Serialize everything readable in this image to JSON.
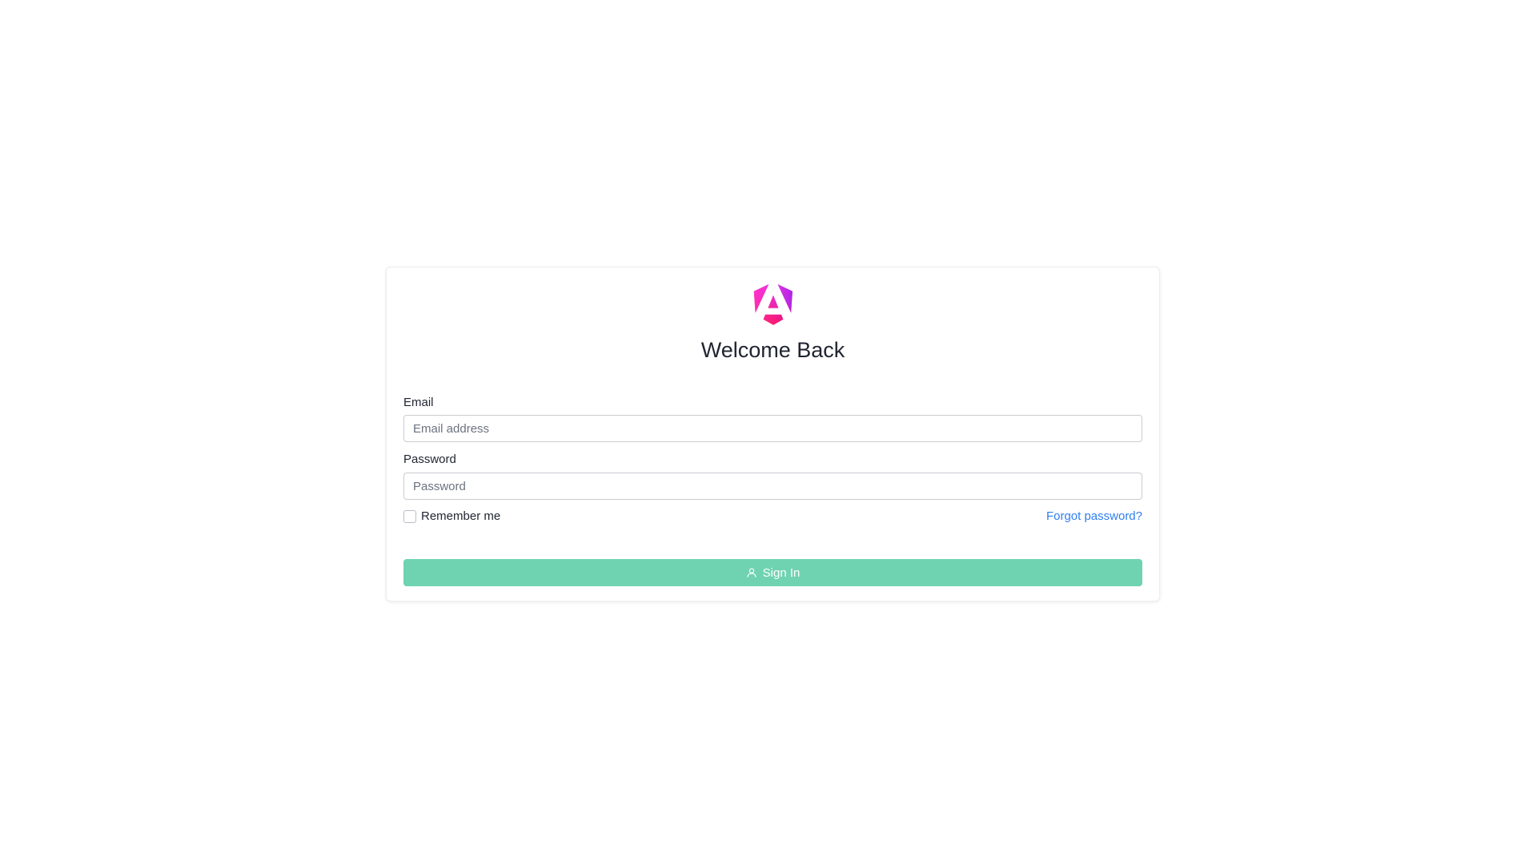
{
  "login": {
    "title": "Welcome Back",
    "logo_icon": "angular-logo-icon",
    "email": {
      "label": "Email",
      "placeholder": "Email address",
      "value": ""
    },
    "password": {
      "label": "Password",
      "placeholder": "Password",
      "value": ""
    },
    "remember": {
      "label": "Remember me",
      "checked": false
    },
    "forgot_link": "Forgot password?",
    "submit": {
      "label": "Sign In",
      "icon": "user-icon"
    }
  },
  "colors": {
    "accent_button": "#6fd3b2",
    "link": "#2f7fef",
    "logo_gradient_start": "#e40035",
    "logo_gradient_mid": "#f60a48",
    "logo_gradient_end": "#9c0ff3"
  }
}
